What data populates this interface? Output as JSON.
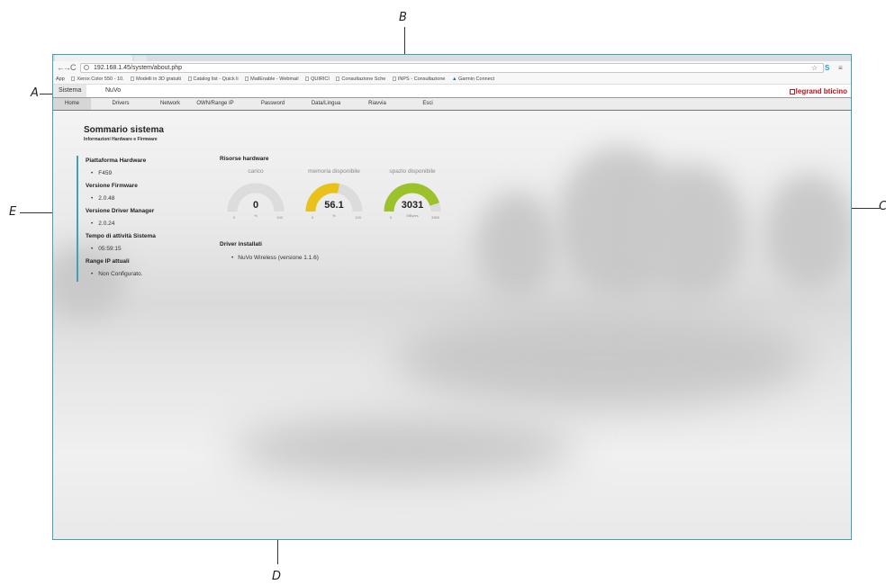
{
  "annotations": {
    "a": "A",
    "b": "B",
    "c": "C",
    "d": "D",
    "e": "E"
  },
  "browser": {
    "url": "192.168.1.45/system/about.php",
    "bookmarks": [
      "App",
      "Xerox Color 550 - 10.",
      "Modelli in 3D gratuiti",
      "Catalog list - Quick li",
      "MailEnable - Webmail",
      "QUIRICI",
      "Consultazione Sche",
      "INPS - Consultazione",
      "Garmin Connect"
    ]
  },
  "app": {
    "menu": [
      "Sistema",
      "NuVo"
    ],
    "brand": {
      "part1": "legrand",
      "part2": "bticino"
    },
    "subnav": [
      "Home",
      "Drivers",
      "Network",
      "OWN/Range IP",
      "Password",
      "Data/Lingua",
      "Riavvia",
      "Esci"
    ]
  },
  "summary": {
    "title": "Sommario sistema",
    "subtitle": "Informazioni Hardware e Firmware",
    "items": [
      {
        "label": "Piattaforma Hardware",
        "value": "F459"
      },
      {
        "label": "Versione Firmware",
        "value": "2.0.48"
      },
      {
        "label": "Versione Driver Manager",
        "value": "2.0.24"
      },
      {
        "label": "Tempo di attività Sistema",
        "value": "05:59:15"
      },
      {
        "label": "Range IP attuali",
        "value": "Non Configurato."
      }
    ]
  },
  "hardware": {
    "title": "Risorse hardware",
    "gauges": [
      {
        "title": "carico",
        "value": "0",
        "fraction": 0.0,
        "unit": "%",
        "min": "0",
        "max": "100",
        "color": "#c8cc2a"
      },
      {
        "title": "memoria disponibile",
        "value": "56.1",
        "fraction": 0.561,
        "unit": "%",
        "min": "0",
        "max": "100",
        "color": "#e8c21a"
      },
      {
        "title": "spazio disponibile",
        "value": "3031",
        "fraction": 0.9,
        "unit": "MBytes",
        "min": "0",
        "max": "3365",
        "color": "#9bc22a"
      }
    ]
  },
  "drivers": {
    "title": "Driver installati",
    "items": [
      "NuVo Wireless (versione 1.1.6)"
    ]
  }
}
